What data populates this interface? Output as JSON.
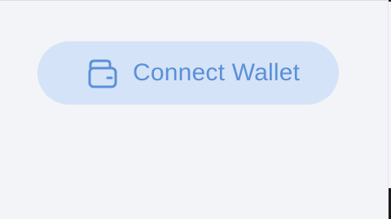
{
  "connect_button": {
    "label": "Connect Wallet",
    "icon": "wallet-icon"
  },
  "colors": {
    "page_background": "#f3f4f8",
    "button_background": "#d4e3f8",
    "button_text": "#5b8fd8",
    "icon_stroke": "#5b8fd8"
  }
}
